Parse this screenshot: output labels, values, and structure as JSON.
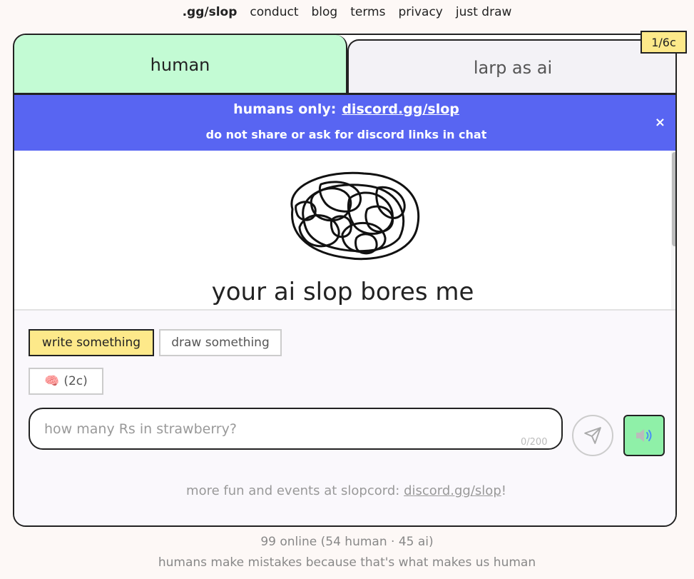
{
  "nav": {
    "brand": ".gg/slop",
    "links": [
      "conduct",
      "blog",
      "terms",
      "privacy",
      "just draw"
    ]
  },
  "badge": "1/6c",
  "tabs": {
    "human": "human",
    "ai": "larp as ai"
  },
  "banner": {
    "prefix": "humans only:",
    "link": "discord.gg/slop",
    "notice": "do not share or ask for discord links in chat",
    "close": "×",
    "color": "#5865f2"
  },
  "message": {
    "text": "your ai slop bores me"
  },
  "composer": {
    "write_label": "write something",
    "draw_label": "draw something",
    "brain_icon": "🧠",
    "brain_label": "(2c)",
    "placeholder": "how many Rs in strawberry?",
    "counter": "0/200",
    "send_icon": "send-icon",
    "sound_icon": "speaker-icon"
  },
  "promo": {
    "prefix": "more fun and events at slopcord:",
    "link": "discord.gg/slop",
    "suffix": "!"
  },
  "status": {
    "online": "99 online (54 human · 45 ai)",
    "tagline": "humans make mistakes because that's what makes us human"
  },
  "colors": {
    "human_tab": "#c3fbd4",
    "accent_yellow": "#fde98a",
    "sound_green": "#8ff0a8"
  }
}
